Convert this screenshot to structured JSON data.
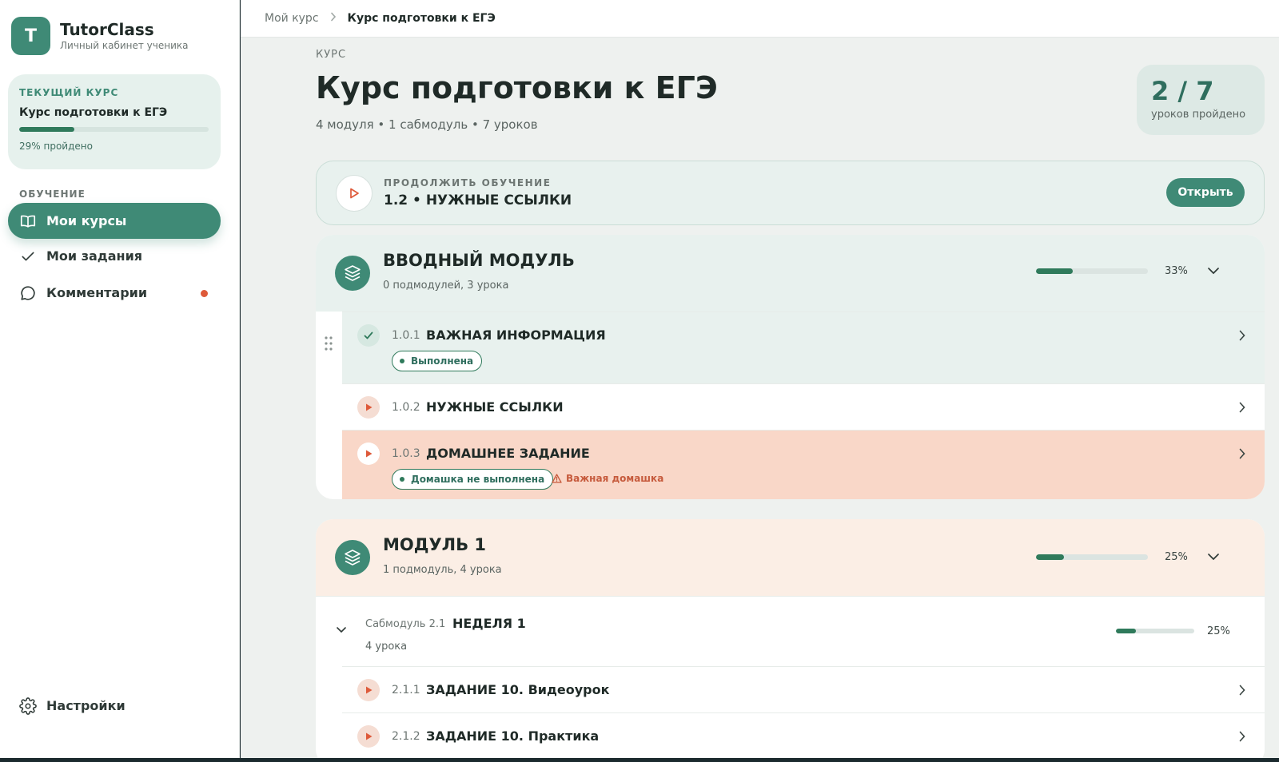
{
  "brand": {
    "logo_letter": "T",
    "name": "TutorClass",
    "subtitle": "Личный кабинет ученика"
  },
  "current_course": {
    "label": "ТЕКУЩИЙ КУРС",
    "title": "Курс подготовки к ЕГЭ",
    "progress": 0.29,
    "progress_text": "29% пройдено"
  },
  "nav": {
    "section_label": "ОБУЧЕНИЕ",
    "items": [
      {
        "label": "Мои курсы",
        "icon": "book-icon",
        "active": true
      },
      {
        "label": "Мои задания",
        "icon": "check-icon",
        "active": false
      },
      {
        "label": "Комментарии",
        "icon": "comment-icon",
        "active": false,
        "has_notification": true
      }
    ],
    "settings_label": "Настройки"
  },
  "breadcrumb": {
    "link": "Мой курс",
    "current": "Курс подготовки к ЕГЭ"
  },
  "course": {
    "kicker": "КУРС",
    "title": "Курс подготовки к ЕГЭ",
    "meta": "4 модуля • 1 сабмодуль • 7 уроков",
    "stats_value": "2 / 7",
    "stats_label": "уроков пройдено"
  },
  "continue": {
    "label": "ПРОДОЛЖИТЬ ОБУЧЕНИЕ",
    "title": "1.2 • НУЖНЫЕ ССЫЛКИ",
    "button": "Открыть"
  },
  "modules": [
    {
      "title": "ВВОДНЫЙ МОДУЛЬ",
      "subtitle": "0 подмодулей, 3 урока",
      "progress": 0.33,
      "progress_text": "33%",
      "lessons": [
        {
          "num": "1.0.1",
          "title": "ВАЖНАЯ ИНФОРМАЦИЯ",
          "status": "done",
          "badge": "Выполнена"
        },
        {
          "num": "1.0.2",
          "title": "НУЖНЫЕ ССЫЛКИ",
          "status": "pending"
        },
        {
          "num": "1.0.3",
          "title": "ДОМАШНЕЕ ЗАДАНИЕ",
          "status": "alert",
          "badge": "Домашка не выполнена",
          "warning": "Важная домашка"
        }
      ]
    },
    {
      "title": "МОДУЛЬ 1",
      "subtitle": "1 подмодуль, 4 урока",
      "progress": 0.25,
      "progress_text": "25%",
      "submodule": {
        "kicker": "Сабмодуль 2.1",
        "title": "НЕДЕЛЯ 1",
        "meta": "4 урока",
        "progress": 0.25,
        "progress_text": "25%",
        "lessons": [
          {
            "num": "2.1.1",
            "title": "ЗАДАНИЕ 10. Видеоурок",
            "status": "pending"
          },
          {
            "num": "2.1.2",
            "title": "ЗАДАНИЕ 10. Практика",
            "status": "pending"
          }
        ]
      }
    }
  ],
  "colors": {
    "accent": "#3f8a76",
    "progress": "#2f7a5b",
    "alert_bg": "#f9d7c8",
    "warning": "#c65a3c",
    "notification": "#de5a3a"
  }
}
